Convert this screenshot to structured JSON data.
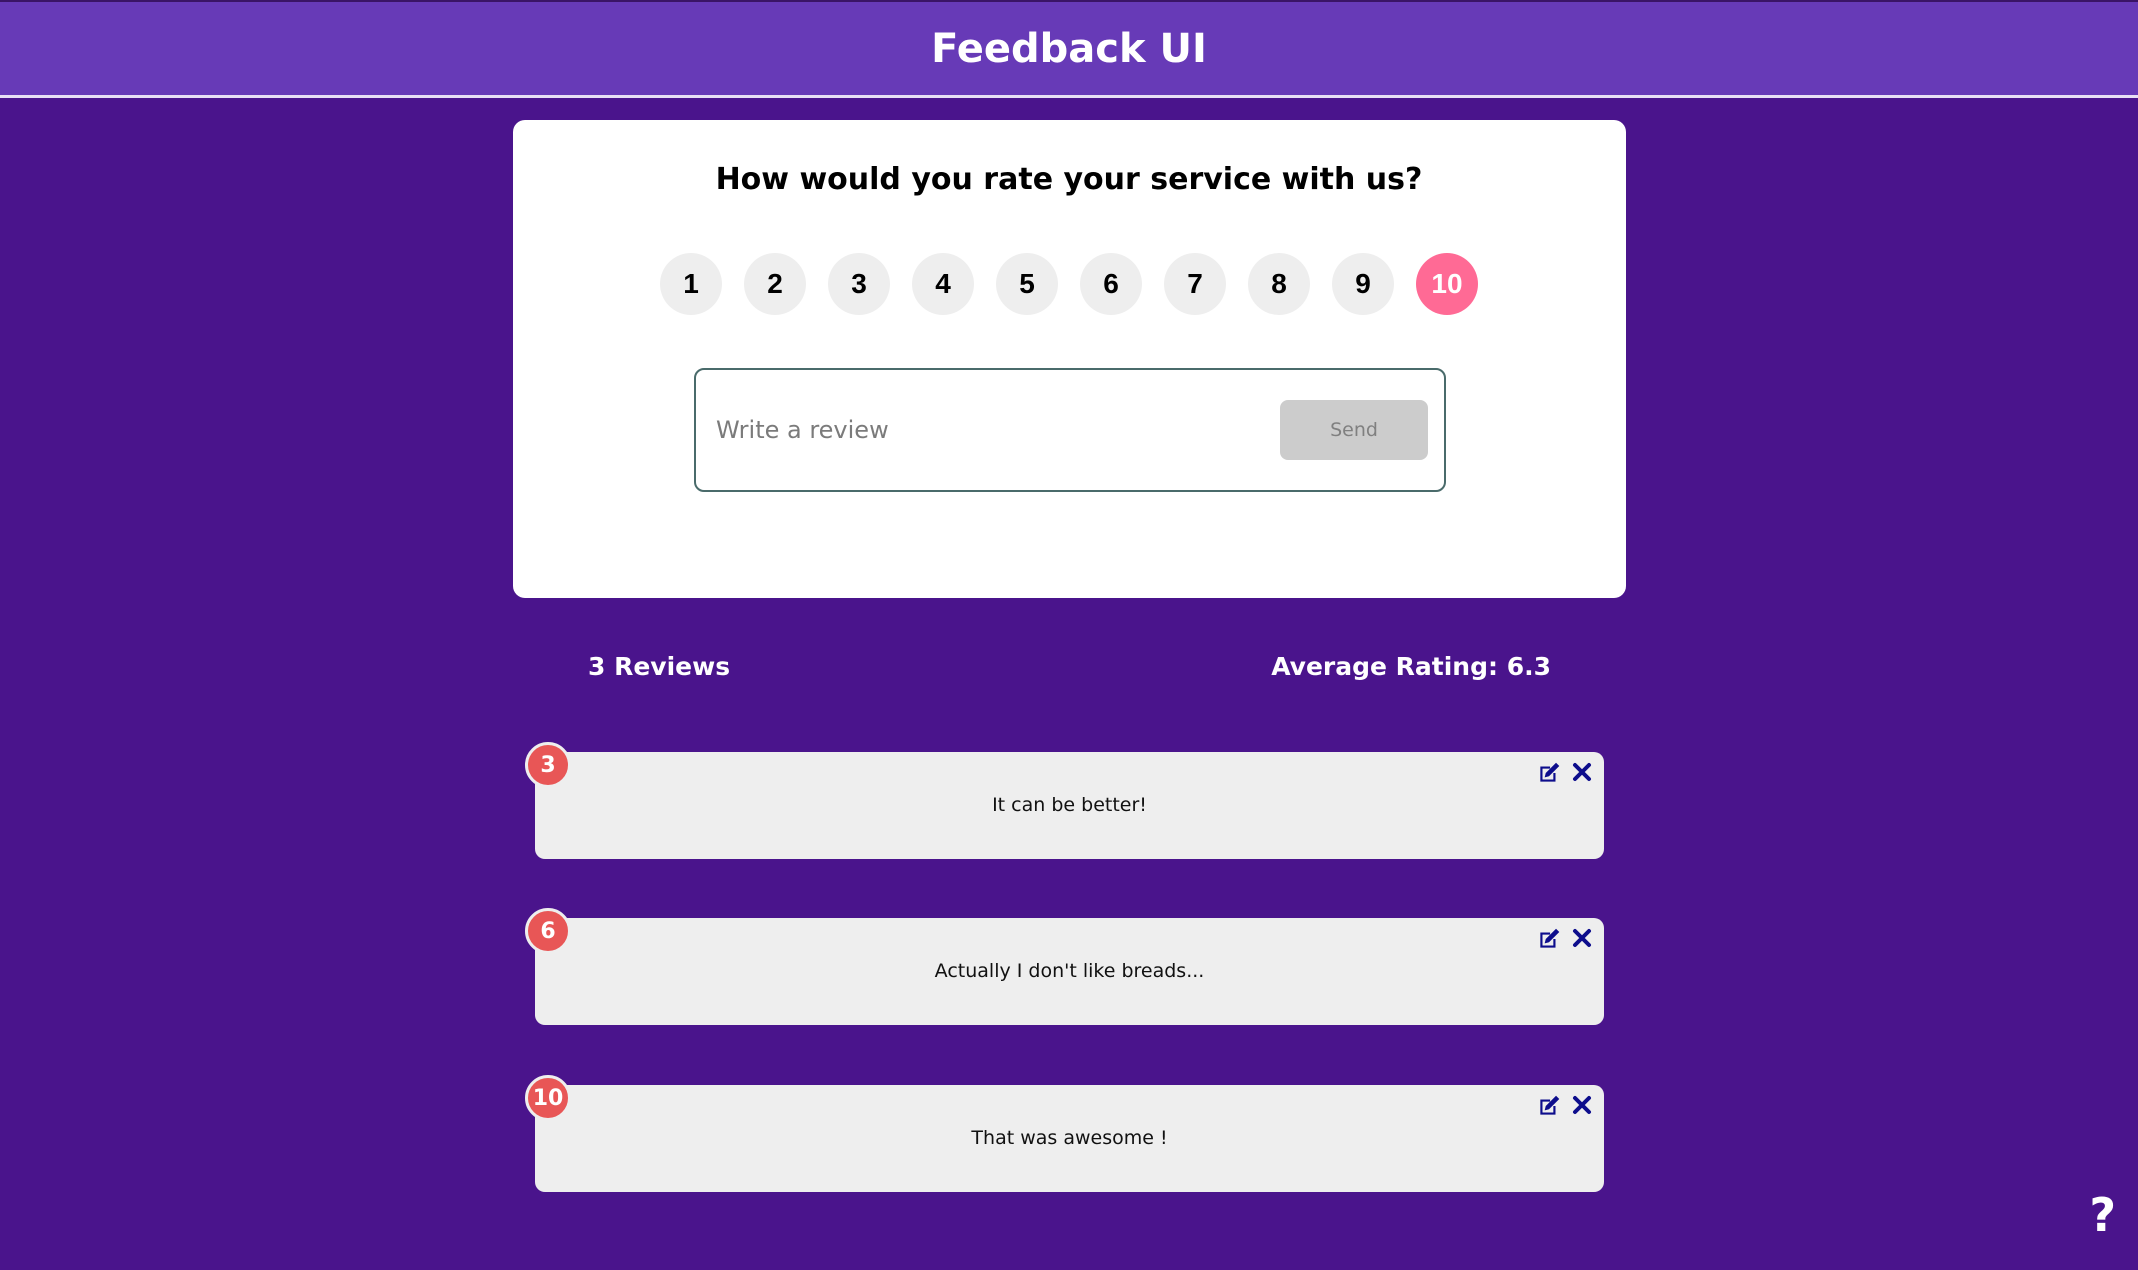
{
  "header": {
    "title": "Feedback UI"
  },
  "form": {
    "question": "How would you rate your service with us?",
    "ratings": [
      "1",
      "2",
      "3",
      "4",
      "5",
      "6",
      "7",
      "8",
      "9",
      "10"
    ],
    "selected_rating": "10",
    "placeholder": "Write a review",
    "send_label": "Send"
  },
  "stats": {
    "count_label": "3 Reviews",
    "average_label": "Average Rating: 6.3"
  },
  "reviews": [
    {
      "rating": "3",
      "text": "It can be better!"
    },
    {
      "rating": "6",
      "text": "Actually I don't like breads..."
    },
    {
      "rating": "10",
      "text": "That was awesome !"
    }
  ],
  "help": {
    "label": "?"
  },
  "colors": {
    "background": "#4a148c",
    "header": "#673ab7",
    "selected_rating": "#ff6a95",
    "badge": "#e85656",
    "icon": "#0d0d8c"
  },
  "icons": [
    "edit-icon",
    "close-icon",
    "question-icon"
  ]
}
